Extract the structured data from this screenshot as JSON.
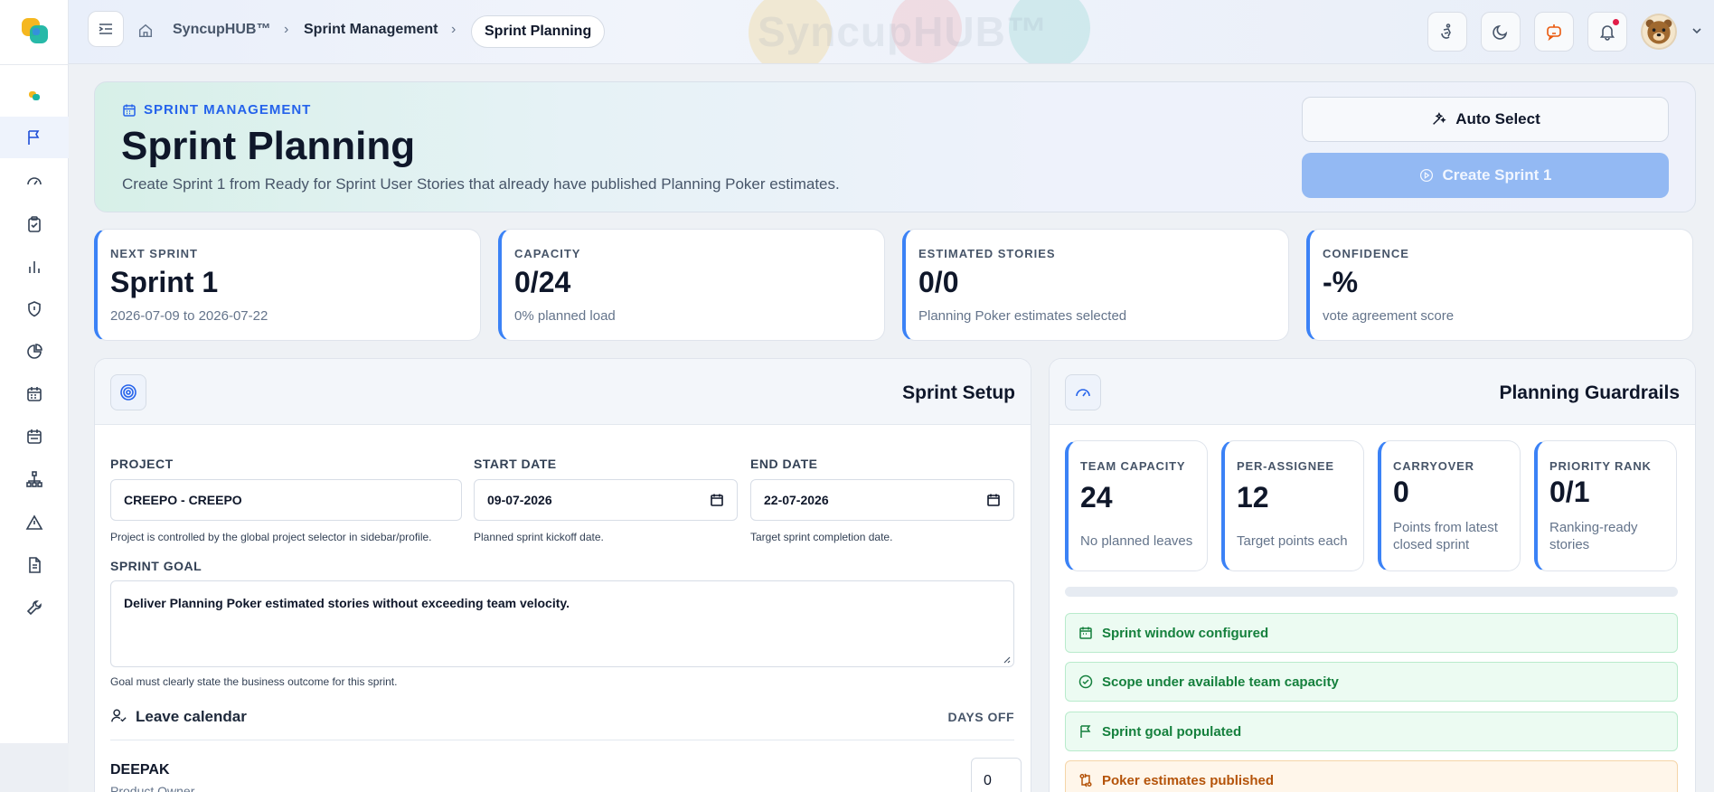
{
  "header": {
    "watermark": "SyncupHUB™",
    "breadcrumb": {
      "root": "SyncupHUB™",
      "section": "Sprint Management",
      "current": "Sprint Planning"
    }
  },
  "hero": {
    "eyebrow": "SPRINT MANAGEMENT",
    "title": "Sprint Planning",
    "description": "Create Sprint 1 from Ready for Sprint User Stories that already have published Planning Poker estimates.",
    "auto_select_label": "Auto Select",
    "create_label": "Create Sprint 1"
  },
  "stats": [
    {
      "label": "NEXT SPRINT",
      "value": "Sprint 1",
      "sub": "2026-07-09 to 2026-07-22"
    },
    {
      "label": "CAPACITY",
      "value": "0/24",
      "sub": "0% planned load"
    },
    {
      "label": "ESTIMATED STORIES",
      "value": "0/0",
      "sub": "Planning Poker estimates selected"
    },
    {
      "label": "CONFIDENCE",
      "value": "-%",
      "sub": "vote agreement score"
    }
  ],
  "setup": {
    "title": "Sprint Setup",
    "project": {
      "label": "PROJECT",
      "value": "CREEPO - CREEPO",
      "help": "Project is controlled by the global project selector in sidebar/profile."
    },
    "start": {
      "label": "START DATE",
      "value": "09-07-2026",
      "help": "Planned sprint kickoff date."
    },
    "end": {
      "label": "END DATE",
      "value": "22-07-2026",
      "help": "Target sprint completion date."
    },
    "goal": {
      "label": "SPRINT GOAL",
      "value": "Deliver Planning Poker estimated stories without exceeding team velocity.",
      "help": "Goal must clearly state the business outcome for this sprint."
    },
    "leave": {
      "title": "Leave calendar",
      "days_off_label": "DAYS OFF"
    },
    "member": {
      "name": "DEEPAK",
      "role": "Product Owner",
      "days_off": "0"
    }
  },
  "guardrails": {
    "title": "Planning Guardrails",
    "cards": [
      {
        "label": "TEAM CAPACITY",
        "value": "24",
        "sub": "No planned leaves"
      },
      {
        "label": "PER-ASSIGNEE",
        "value": "12",
        "sub": "Target points each"
      },
      {
        "label": "CARRYOVER",
        "value": "0",
        "sub": "Points from latest closed sprint"
      },
      {
        "label": "PRIORITY RANK",
        "value": "0/1",
        "sub": "Ranking-ready stories"
      }
    ],
    "load_percent": 0,
    "checks": [
      {
        "label": "Sprint window configured",
        "status": "ok"
      },
      {
        "label": "Scope under available team capacity",
        "status": "ok"
      },
      {
        "label": "Sprint goal populated",
        "status": "ok"
      },
      {
        "label": "Poker estimates published",
        "status": "warn"
      }
    ]
  },
  "colors": {
    "accent": "#3b82f6",
    "ok": "#15803d",
    "warn": "#b45309"
  }
}
